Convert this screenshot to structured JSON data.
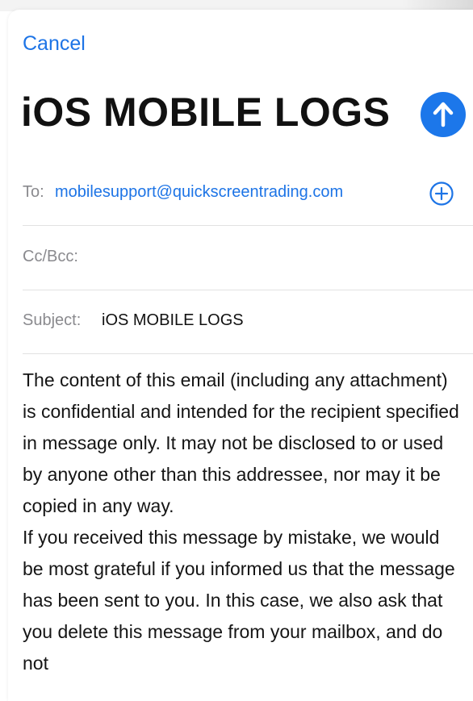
{
  "header": {
    "cancel_label": "Cancel",
    "title": "iOS MOBILE LOGS",
    "send_icon": "arrow-up-icon",
    "accent_color": "#1c77ea"
  },
  "fields": {
    "to_label": "To:",
    "to_value": "mobilesupport@quickscreentrading.com",
    "add_icon": "plus-circle-icon",
    "cc_label": "Cc/Bcc:",
    "subject_label": "Subject:",
    "subject_value": "iOS MOBILE LOGS"
  },
  "body": {
    "paragraph_1": "The content of this email (including any attachment) is confidential and intended for the recipient specified in message only. It may not be disclosed to or used by anyone other than this addressee, nor may it be copied in any way.",
    "paragraph_2": "If you received this message by mistake, we would be most grateful if you informed us that the message has been sent to you. In this case, we also ask that you delete this message from your mailbox, and do not"
  }
}
